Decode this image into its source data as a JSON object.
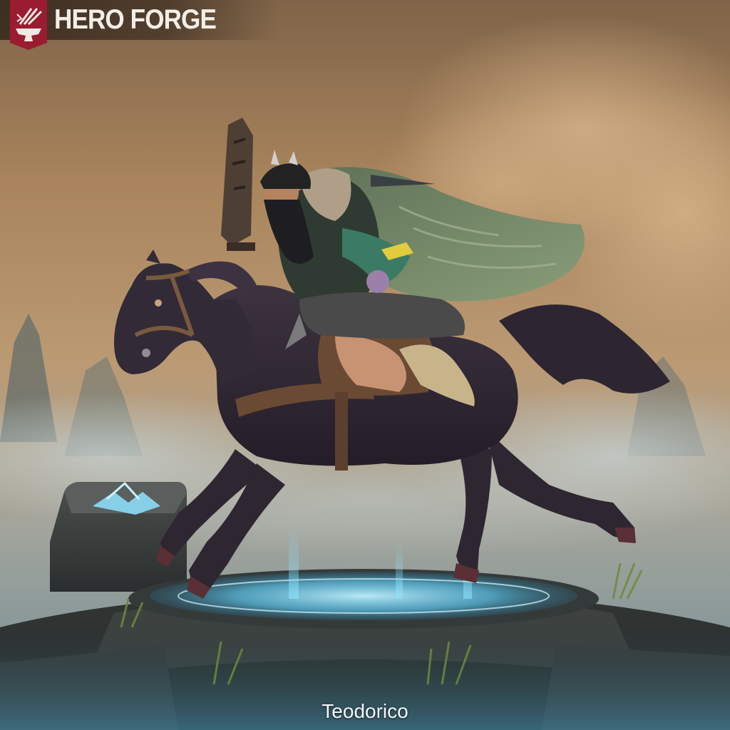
{
  "header": {
    "brand_name": "HERO FORGE",
    "logo_icon": "hero-forge-anvil-icon",
    "brand_color": "#9b1b30"
  },
  "viewer": {
    "character_name": "Teodorico",
    "subject": "mounted-warrior-miniature",
    "colors": {
      "sky": "#b08a62",
      "horse": "#2f2733",
      "cloak": "#6f8360",
      "base_glow": "#6fd6ff"
    }
  }
}
